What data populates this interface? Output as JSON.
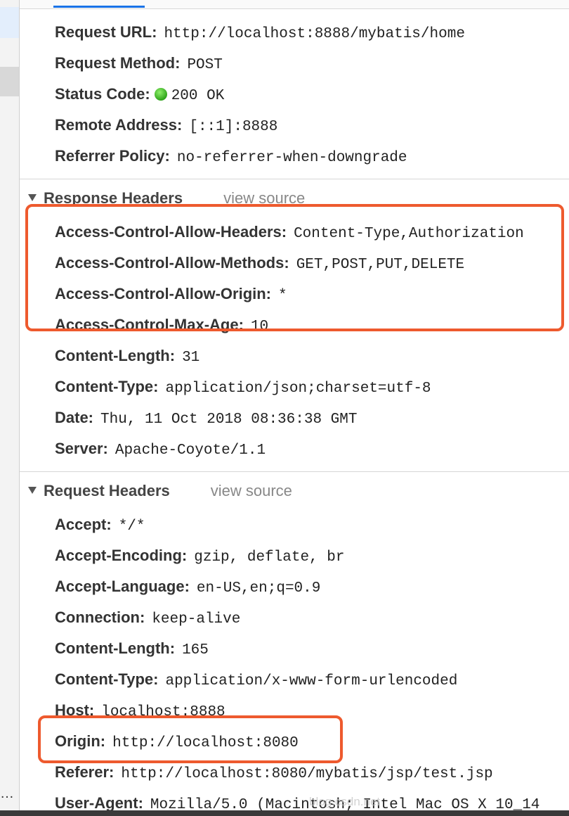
{
  "general": [
    {
      "key": "Request URL:",
      "value": "http://localhost:8888/mybatis/home"
    },
    {
      "key": "Request Method:",
      "value": "POST"
    },
    {
      "key": "Status Code:",
      "value": "200 OK"
    },
    {
      "key": "Remote Address:",
      "value": "[::1]:8888"
    },
    {
      "key": "Referrer Policy:",
      "value": "no-referrer-when-downgrade"
    }
  ],
  "response_headers": {
    "title": "Response Headers",
    "view_source": "view source",
    "items": [
      {
        "key": "Access-Control-Allow-Headers:",
        "value": "Content-Type,Authorization"
      },
      {
        "key": "Access-Control-Allow-Methods:",
        "value": "GET,POST,PUT,DELETE"
      },
      {
        "key": "Access-Control-Allow-Origin:",
        "value": "*"
      },
      {
        "key": "Access-Control-Max-Age:",
        "value": "10"
      },
      {
        "key": "Content-Length:",
        "value": "31"
      },
      {
        "key": "Content-Type:",
        "value": "application/json;charset=utf-8"
      },
      {
        "key": "Date:",
        "value": "Thu, 11 Oct 2018 08:36:38 GMT"
      },
      {
        "key": "Server:",
        "value": "Apache-Coyote/1.1"
      }
    ]
  },
  "request_headers": {
    "title": "Request Headers",
    "view_source": "view source",
    "items": [
      {
        "key": "Accept:",
        "value": "*/*"
      },
      {
        "key": "Accept-Encoding:",
        "value": "gzip, deflate, br"
      },
      {
        "key": "Accept-Language:",
        "value": "en-US,en;q=0.9"
      },
      {
        "key": "Connection:",
        "value": "keep-alive"
      },
      {
        "key": "Content-Length:",
        "value": "165"
      },
      {
        "key": "Content-Type:",
        "value": "application/x-www-form-urlencoded"
      },
      {
        "key": "Host:",
        "value": "localhost:8888"
      },
      {
        "key": "Origin:",
        "value": "http://localhost:8080"
      },
      {
        "key": "Referer:",
        "value": "http://localhost:8080/mybatis/jsp/test.jsp"
      },
      {
        "key": "User-Agent:",
        "value": "Mozilla/5.0 (Macintosh; Intel Mac OS X 10_14"
      }
    ]
  },
  "sidebar": {
    "ellipsis": "…"
  },
  "watermark": "blog.csdn.net",
  "colors": {
    "highlight": "#ee5a2e",
    "status_ok": "#2fa51a",
    "tab_active": "#1a73e8"
  }
}
